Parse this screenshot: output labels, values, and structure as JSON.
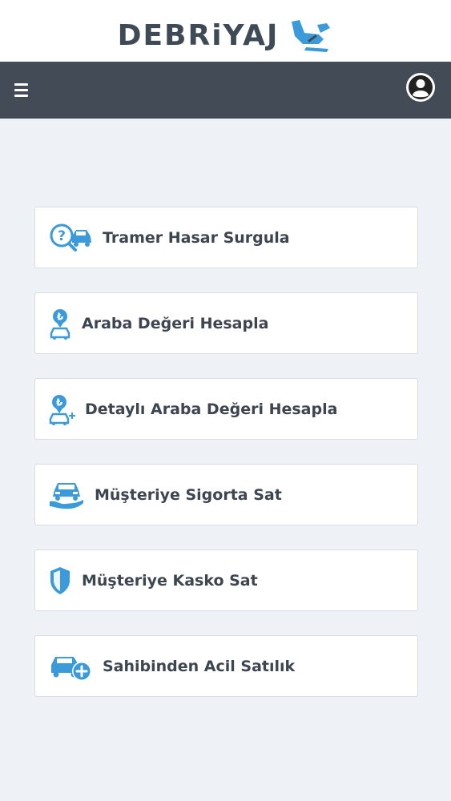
{
  "header": {
    "logo_text": "DEBRiYAJ",
    "menu_icon": "hamburger-menu-icon",
    "user_icon": "user-account-icon"
  },
  "colors": {
    "accent": "#3b9ad9",
    "navbar": "#434c56",
    "text": "#3d4650",
    "background": "#eef1f6"
  },
  "menu": {
    "items": [
      {
        "label": "Tramer Hasar Surgula",
        "icon": "car-damage-search-icon"
      },
      {
        "label": "Araba Değeri Hesapla",
        "icon": "car-value-lira-icon"
      },
      {
        "label": "Detaylı Araba Değeri Hesapla",
        "icon": "car-value-detailed-icon"
      },
      {
        "label": "Müşteriye Sigorta Sat",
        "icon": "car-insurance-hand-icon"
      },
      {
        "label": "Müşteriye Kasko Sat",
        "icon": "shield-icon"
      },
      {
        "label": "Sahibinden Acil Satılık",
        "icon": "car-add-icon"
      }
    ]
  }
}
